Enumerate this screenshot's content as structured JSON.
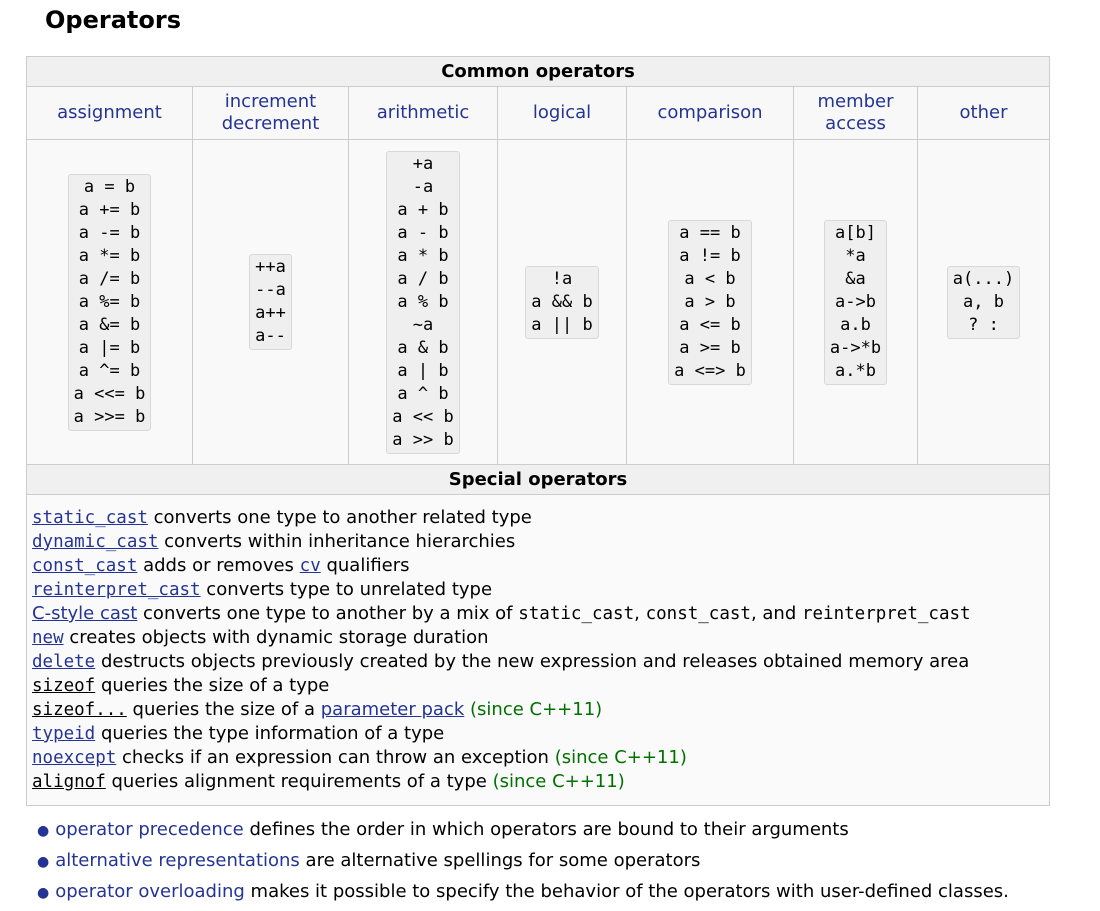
{
  "page_title": "Operators",
  "common": {
    "caption": "Common operators",
    "columns": [
      {
        "header": [
          "assignment"
        ],
        "items": [
          "a = b",
          "a += b",
          "a -= b",
          "a *= b",
          "a /= b",
          "a %= b",
          "a &= b",
          "a |= b",
          "a ^= b",
          "a <<= b",
          "a >>= b"
        ]
      },
      {
        "header": [
          "increment",
          "decrement"
        ],
        "items": [
          "++a",
          "--a",
          "a++",
          "a--"
        ]
      },
      {
        "header": [
          "arithmetic"
        ],
        "items": [
          "+a",
          "-a",
          "a + b",
          "a - b",
          "a * b",
          "a / b",
          "a % b",
          "~a",
          "a & b",
          "a | b",
          "a ^ b",
          "a << b",
          "a >> b"
        ]
      },
      {
        "header": [
          "logical"
        ],
        "items": [
          "!a",
          "a && b",
          "a || b"
        ]
      },
      {
        "header": [
          "comparison"
        ],
        "items": [
          "a == b",
          "a != b",
          "a < b",
          "a > b",
          "a <= b",
          "a >= b",
          "a <=> b"
        ]
      },
      {
        "header": [
          "member",
          "access"
        ],
        "items": [
          "a[b]",
          "*a",
          "&a",
          "a->b",
          "a.b",
          "a->*b",
          "a.*b"
        ]
      },
      {
        "header": [
          "other"
        ],
        "items": [
          "a(...)",
          "a, b",
          "? :"
        ]
      }
    ]
  },
  "special": {
    "caption": "Special operators",
    "lines": [
      {
        "kw": "static_cast",
        "text": " converts one type to another related type"
      },
      {
        "kw": "dynamic_cast",
        "text": " converts within inheritance hierarchies"
      },
      {
        "kw": "const_cast",
        "text": " adds or removes ",
        "link": "cv",
        "text2": " qualifiers"
      },
      {
        "kw": "reinterpret_cast",
        "text": " converts type to unrelated type"
      },
      {
        "kw": "C-style cast",
        "text": " converts one type to another by a mix of ",
        "c1": "static_cast",
        "s1": ", ",
        "c2": "const_cast",
        "s2": ", and ",
        "c3": "reinterpret_cast"
      },
      {
        "kw": "new",
        "text": " creates objects with dynamic storage duration"
      },
      {
        "kw": "delete",
        "text": " destructs objects previously created by the new expression and releases obtained memory area"
      },
      {
        "kw": "sizeof",
        "text": " queries the size of a type"
      },
      {
        "kw": "sizeof...",
        "text": " queries the size of a ",
        "link": "parameter pack",
        "since": " (since C++11)"
      },
      {
        "kw": "typeid",
        "text": " queries the type information of a type"
      },
      {
        "kw": "noexcept",
        "text": " checks if an expression can throw an exception",
        "since": " (since C++11)"
      },
      {
        "kw": "alignof",
        "text": " queries alignment requirements of a type",
        "since": " (since C++11)"
      }
    ]
  },
  "notes": [
    {
      "link": "operator precedence",
      "text": " defines the order in which operators are bound to their arguments"
    },
    {
      "link": "alternative representations",
      "text": " are alternative spellings for some operators"
    },
    {
      "link": "operator overloading",
      "text": " makes it possible to specify the behavior of the operators with user-defined classes."
    }
  ]
}
